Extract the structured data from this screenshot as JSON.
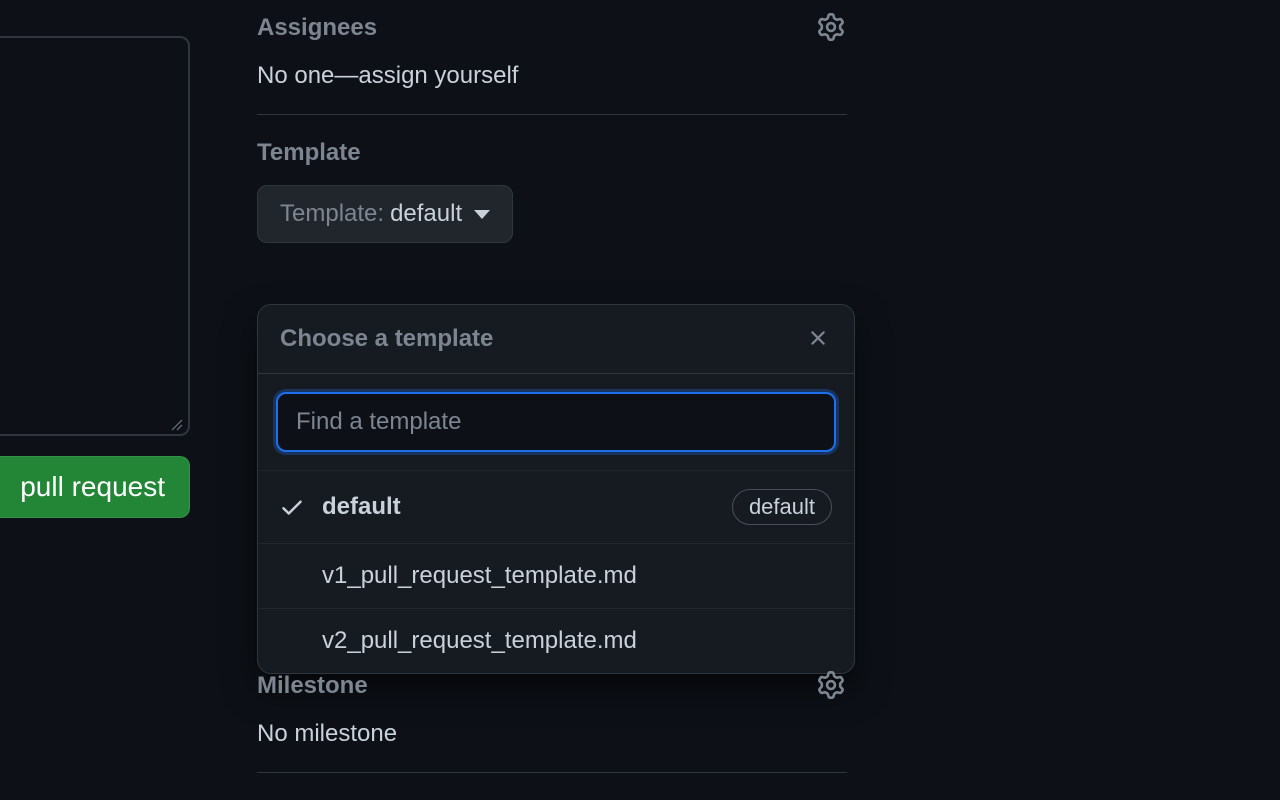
{
  "sidebar": {
    "assignees": {
      "title": "Assignees",
      "body_prefix": "No one—",
      "assign_link": "assign yourself"
    },
    "template": {
      "title": "Template",
      "button_label": "Template: ",
      "button_value": "default"
    },
    "milestone": {
      "title": "Milestone",
      "body": "No milestone"
    }
  },
  "popover": {
    "title": "Choose a template",
    "search_placeholder": "Find a template",
    "items": [
      {
        "label": "default",
        "selected": true,
        "badge": "default"
      },
      {
        "label": "v1_pull_request_template.md",
        "selected": false,
        "badge": null
      },
      {
        "label": "v2_pull_request_template.md",
        "selected": false,
        "badge": null
      }
    ]
  },
  "buttons": {
    "create_pr": "pull request"
  }
}
